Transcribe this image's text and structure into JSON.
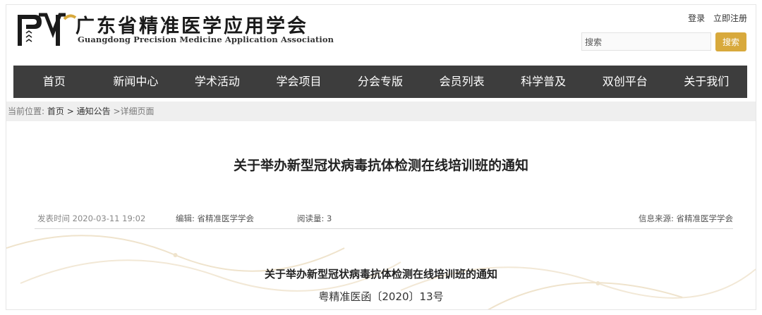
{
  "header": {
    "org_name_cn": "广东省精准医学应用学会",
    "org_name_en": "Guangdong Precision Medicine Application Association"
  },
  "top_links": {
    "login": "登录",
    "register": "立即注册"
  },
  "search": {
    "value": "搜索",
    "button_label": "搜索"
  },
  "nav": {
    "items": [
      "首页",
      "新闻中心",
      "学术活动",
      "学会项目",
      "分会专版",
      "会员列表",
      "科学普及",
      "双创平台",
      "关于我们"
    ]
  },
  "breadcrumb": {
    "label": "当前位置:",
    "home": "首页",
    "sep": ">",
    "section": "通知公告",
    "current": ">详细页面"
  },
  "article": {
    "title": "关于举办新型冠状病毒抗体检测在线培训班的通知",
    "publish_time": "发表时间 2020-03-11 19:02",
    "editor": "编辑: 省精准医学学会",
    "reads": "阅读量: 3",
    "source": "信息来源: 省精准医学学会",
    "body_heading": "关于举办新型冠状病毒抗体检测在线培训班的通知",
    "doc_number": "粤精准医函〔2020〕13号"
  },
  "colors": {
    "nav_bg": "#3d3d3d",
    "accent": "#d8a93c",
    "crumb_bg": "#efefef"
  }
}
